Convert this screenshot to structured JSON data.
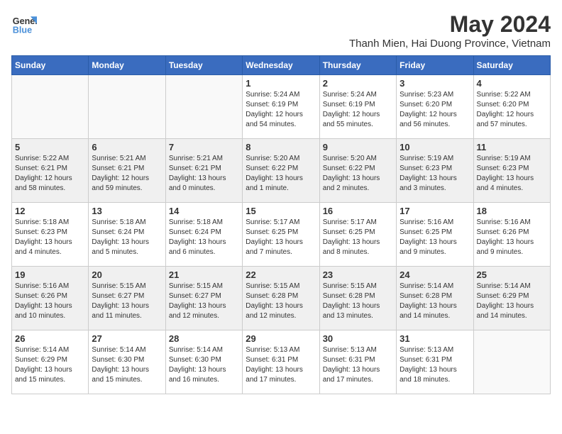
{
  "logo": {
    "text_general": "General",
    "text_blue": "Blue"
  },
  "title": "May 2024",
  "subtitle": "Thanh Mien, Hai Duong Province, Vietnam",
  "days_of_week": [
    "Sunday",
    "Monday",
    "Tuesday",
    "Wednesday",
    "Thursday",
    "Friday",
    "Saturday"
  ],
  "weeks": [
    [
      {
        "day": "",
        "info": ""
      },
      {
        "day": "",
        "info": ""
      },
      {
        "day": "",
        "info": ""
      },
      {
        "day": "1",
        "info": "Sunrise: 5:24 AM\nSunset: 6:19 PM\nDaylight: 12 hours\nand 54 minutes."
      },
      {
        "day": "2",
        "info": "Sunrise: 5:24 AM\nSunset: 6:19 PM\nDaylight: 12 hours\nand 55 minutes."
      },
      {
        "day": "3",
        "info": "Sunrise: 5:23 AM\nSunset: 6:20 PM\nDaylight: 12 hours\nand 56 minutes."
      },
      {
        "day": "4",
        "info": "Sunrise: 5:22 AM\nSunset: 6:20 PM\nDaylight: 12 hours\nand 57 minutes."
      }
    ],
    [
      {
        "day": "5",
        "info": "Sunrise: 5:22 AM\nSunset: 6:21 PM\nDaylight: 12 hours\nand 58 minutes."
      },
      {
        "day": "6",
        "info": "Sunrise: 5:21 AM\nSunset: 6:21 PM\nDaylight: 12 hours\nand 59 minutes."
      },
      {
        "day": "7",
        "info": "Sunrise: 5:21 AM\nSunset: 6:21 PM\nDaylight: 13 hours\nand 0 minutes."
      },
      {
        "day": "8",
        "info": "Sunrise: 5:20 AM\nSunset: 6:22 PM\nDaylight: 13 hours\nand 1 minute."
      },
      {
        "day": "9",
        "info": "Sunrise: 5:20 AM\nSunset: 6:22 PM\nDaylight: 13 hours\nand 2 minutes."
      },
      {
        "day": "10",
        "info": "Sunrise: 5:19 AM\nSunset: 6:23 PM\nDaylight: 13 hours\nand 3 minutes."
      },
      {
        "day": "11",
        "info": "Sunrise: 5:19 AM\nSunset: 6:23 PM\nDaylight: 13 hours\nand 4 minutes."
      }
    ],
    [
      {
        "day": "12",
        "info": "Sunrise: 5:18 AM\nSunset: 6:23 PM\nDaylight: 13 hours\nand 4 minutes."
      },
      {
        "day": "13",
        "info": "Sunrise: 5:18 AM\nSunset: 6:24 PM\nDaylight: 13 hours\nand 5 minutes."
      },
      {
        "day": "14",
        "info": "Sunrise: 5:18 AM\nSunset: 6:24 PM\nDaylight: 13 hours\nand 6 minutes."
      },
      {
        "day": "15",
        "info": "Sunrise: 5:17 AM\nSunset: 6:25 PM\nDaylight: 13 hours\nand 7 minutes."
      },
      {
        "day": "16",
        "info": "Sunrise: 5:17 AM\nSunset: 6:25 PM\nDaylight: 13 hours\nand 8 minutes."
      },
      {
        "day": "17",
        "info": "Sunrise: 5:16 AM\nSunset: 6:25 PM\nDaylight: 13 hours\nand 9 minutes."
      },
      {
        "day": "18",
        "info": "Sunrise: 5:16 AM\nSunset: 6:26 PM\nDaylight: 13 hours\nand 9 minutes."
      }
    ],
    [
      {
        "day": "19",
        "info": "Sunrise: 5:16 AM\nSunset: 6:26 PM\nDaylight: 13 hours\nand 10 minutes."
      },
      {
        "day": "20",
        "info": "Sunrise: 5:15 AM\nSunset: 6:27 PM\nDaylight: 13 hours\nand 11 minutes."
      },
      {
        "day": "21",
        "info": "Sunrise: 5:15 AM\nSunset: 6:27 PM\nDaylight: 13 hours\nand 12 minutes."
      },
      {
        "day": "22",
        "info": "Sunrise: 5:15 AM\nSunset: 6:28 PM\nDaylight: 13 hours\nand 12 minutes."
      },
      {
        "day": "23",
        "info": "Sunrise: 5:15 AM\nSunset: 6:28 PM\nDaylight: 13 hours\nand 13 minutes."
      },
      {
        "day": "24",
        "info": "Sunrise: 5:14 AM\nSunset: 6:28 PM\nDaylight: 13 hours\nand 14 minutes."
      },
      {
        "day": "25",
        "info": "Sunrise: 5:14 AM\nSunset: 6:29 PM\nDaylight: 13 hours\nand 14 minutes."
      }
    ],
    [
      {
        "day": "26",
        "info": "Sunrise: 5:14 AM\nSunset: 6:29 PM\nDaylight: 13 hours\nand 15 minutes."
      },
      {
        "day": "27",
        "info": "Sunrise: 5:14 AM\nSunset: 6:30 PM\nDaylight: 13 hours\nand 15 minutes."
      },
      {
        "day": "28",
        "info": "Sunrise: 5:14 AM\nSunset: 6:30 PM\nDaylight: 13 hours\nand 16 minutes."
      },
      {
        "day": "29",
        "info": "Sunrise: 5:13 AM\nSunset: 6:31 PM\nDaylight: 13 hours\nand 17 minutes."
      },
      {
        "day": "30",
        "info": "Sunrise: 5:13 AM\nSunset: 6:31 PM\nDaylight: 13 hours\nand 17 minutes."
      },
      {
        "day": "31",
        "info": "Sunrise: 5:13 AM\nSunset: 6:31 PM\nDaylight: 13 hours\nand 18 minutes."
      },
      {
        "day": "",
        "info": ""
      }
    ]
  ]
}
